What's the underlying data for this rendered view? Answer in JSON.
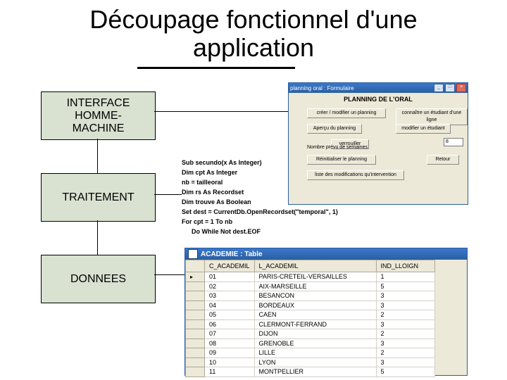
{
  "title_line1": "Découpage fonctionnel d'une",
  "title_line2": "application",
  "layers": {
    "ihm": "INTERFACE\nHOMME-\nMACHINE",
    "trt": "TRAITEMENT",
    "don": "DONNEES"
  },
  "code": {
    "l1": "Sub secundo(x As Integer)",
    "l2": "Dim cpt As Integer",
    "l3": "nb = tailleoral",
    "l4": "Dim rs As Recordset",
    "l5": "Dim trouve As Boolean",
    "l6": "Set dest = CurrentDb.OpenRecordset(\"temporal\", 1)",
    "l7": "For cpt = 1 To nb",
    "l8": "Do While Not dest.EOF"
  },
  "form": {
    "title": "planning oral : Formulaire",
    "heading": "PLANNING DE L'ORAL",
    "btn_creer": "créer / modifier un planning",
    "btn_connaitre": "connaître un étudiant d'une ligne",
    "btn_apercu": "Aperçu du planning",
    "btn_modifier": "modifier un étudiant",
    "btn_verrouiller": "verrouiller",
    "btn_reinit": "Réinitialiser le planning",
    "btn_liste": "liste des modifications qu'intervention",
    "btn_retour": "Retour",
    "lbl_nb": "Nombre prévu de semaines",
    "val_nb": "8"
  },
  "table": {
    "title": "ACADEMIE : Table",
    "icon_name": "table-icon",
    "headers": {
      "c": "C_ACADEMIL",
      "l": "L_ACADEMIL",
      "i": "IND_LLOIGN"
    },
    "rows": [
      {
        "c": "01",
        "l": "PARIS-CRETEIL-VERSAILLES",
        "i": "1"
      },
      {
        "c": "02",
        "l": "AIX-MARSEILLE",
        "i": "5"
      },
      {
        "c": "03",
        "l": "BESANCON",
        "i": "3"
      },
      {
        "c": "04",
        "l": "BORDEAUX",
        "i": "3"
      },
      {
        "c": "05",
        "l": "CAEN",
        "i": "2"
      },
      {
        "c": "06",
        "l": "CLERMONT-FERRAND",
        "i": "3"
      },
      {
        "c": "07",
        "l": "DIJON",
        "i": "2"
      },
      {
        "c": "08",
        "l": "GRENOBLE",
        "i": "3"
      },
      {
        "c": "09",
        "l": "LILLE",
        "i": "2"
      },
      {
        "c": "10",
        "l": "LYON",
        "i": "3"
      },
      {
        "c": "11",
        "l": "MONTPELLIER",
        "i": "5"
      }
    ]
  }
}
